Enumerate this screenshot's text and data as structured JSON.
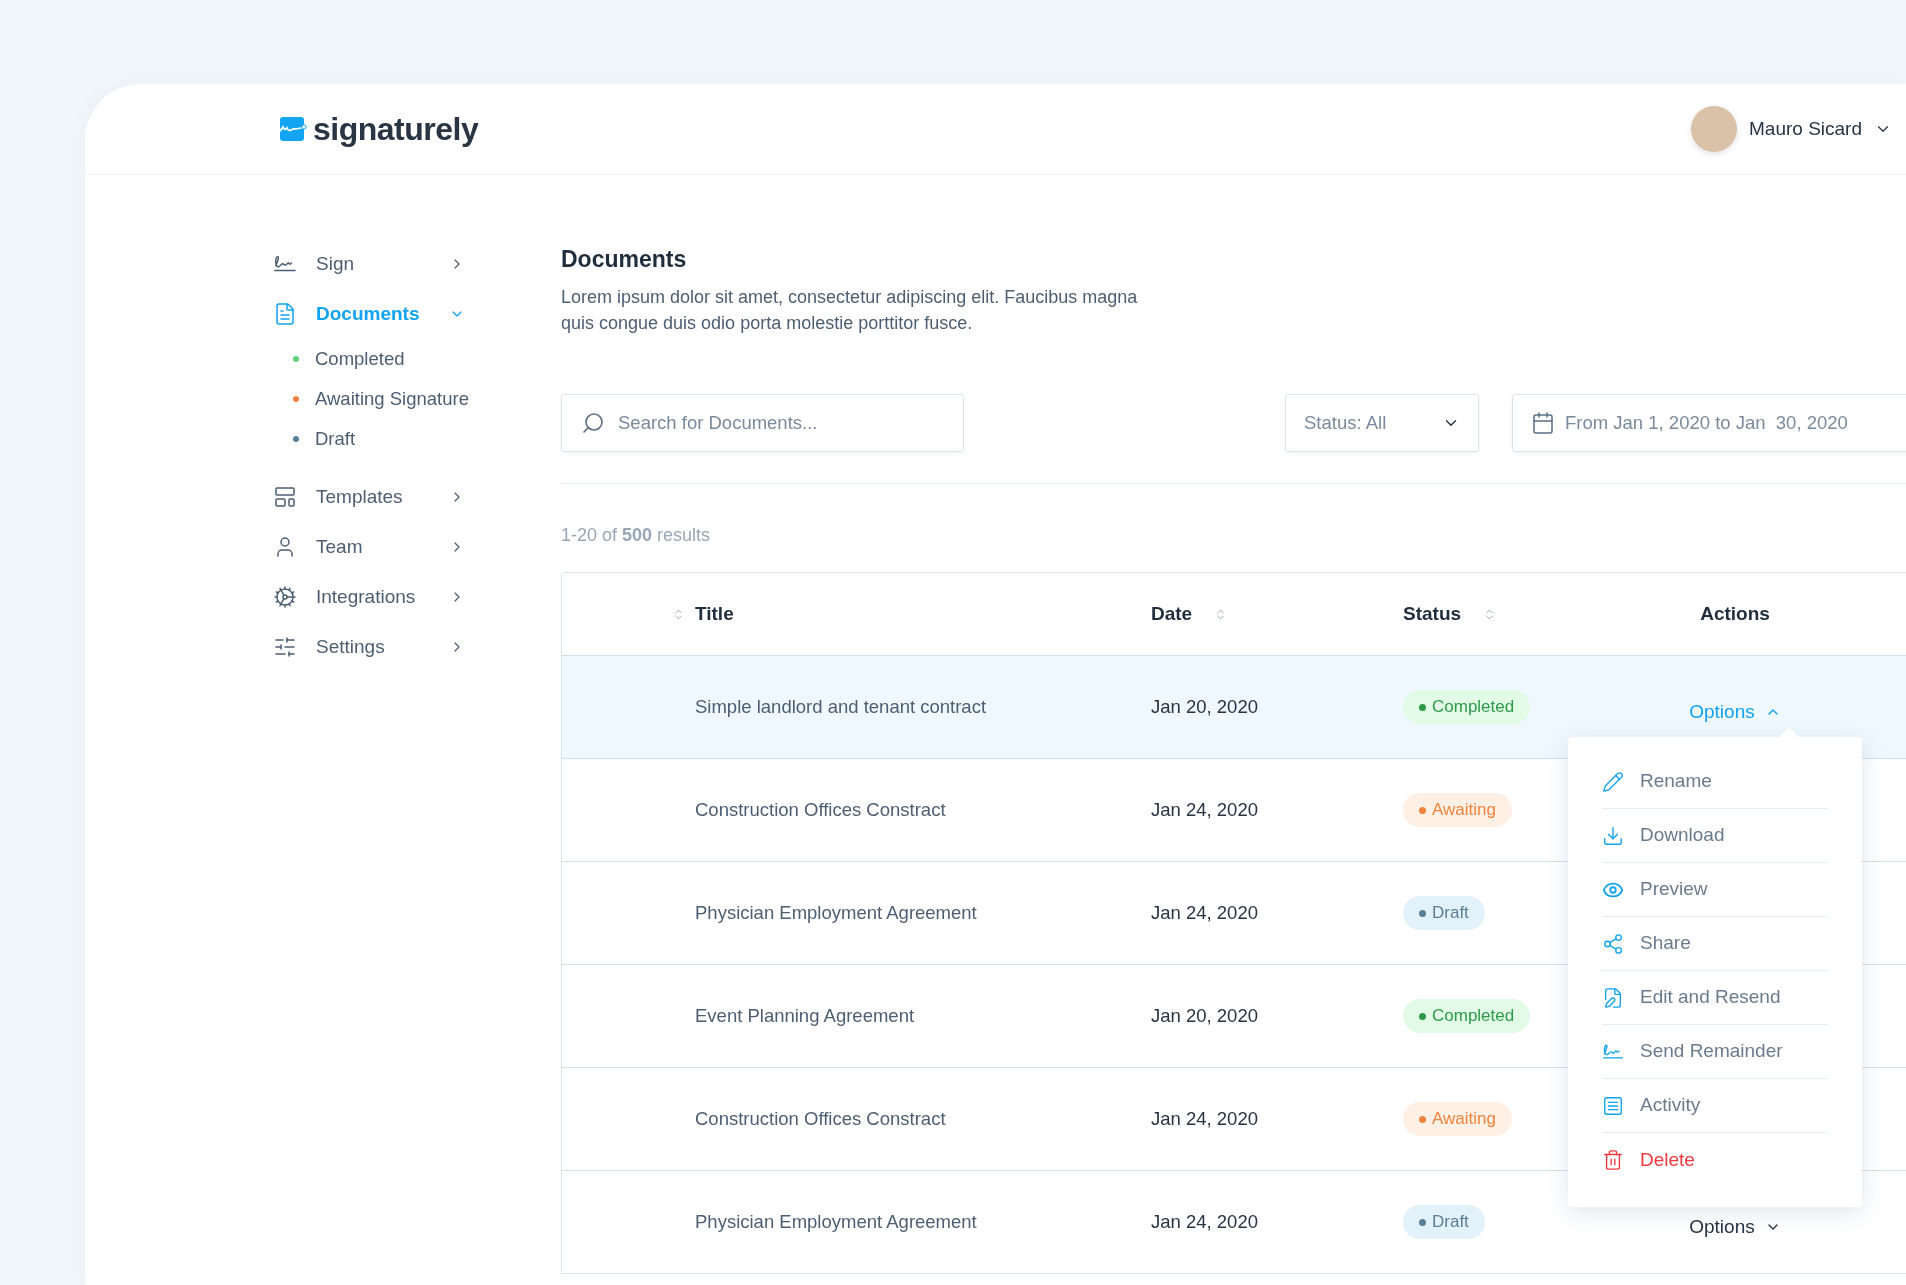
{
  "brand": {
    "name": "signaturely"
  },
  "user": {
    "name": "Mauro Sicard"
  },
  "sidebar": {
    "items": [
      {
        "label": "Sign",
        "selected": false,
        "expanded": false
      },
      {
        "label": "Documents",
        "selected": true,
        "expanded": true,
        "children": [
          {
            "label": "Completed",
            "color": "#5fd47a"
          },
          {
            "label": "Awaiting Signature",
            "color": "#f0843c"
          },
          {
            "label": "Draft",
            "color": "#5a7e95"
          }
        ]
      },
      {
        "label": "Templates",
        "selected": false,
        "expanded": false
      },
      {
        "label": "Team",
        "selected": false,
        "expanded": false
      },
      {
        "label": "Integrations",
        "selected": false,
        "expanded": false
      },
      {
        "label": "Settings",
        "selected": false,
        "expanded": false
      }
    ]
  },
  "page": {
    "title": "Documents",
    "description": "Lorem ipsum dolor sit amet, consectetur adipiscing elit. Faucibus magna quis congue duis odio porta molestie porttitor fusce."
  },
  "filters": {
    "search": {
      "placeholder": "Search for Documents..."
    },
    "status": {
      "value": "Status: All"
    },
    "date_range": {
      "value": "From Jan 1, 2020 to Jan  30, 2020"
    }
  },
  "results": "1-20 of **500** results",
  "table": {
    "columns": [
      {
        "label": "Title",
        "sortable": true
      },
      {
        "label": "Date",
        "sortable": true
      },
      {
        "label": "Status",
        "sortable": true
      },
      {
        "label": "Actions",
        "sortable": false
      }
    ],
    "rows": [
      {
        "title": "Simple landlord and tenant contract",
        "date": "Jan 20, 2020",
        "status": {
          "label": "Completed",
          "kind": "completed"
        },
        "selected": true,
        "action": {
          "label": "Options",
          "expanded": true
        }
      },
      {
        "title": "Construction Offices Constract",
        "date": "Jan 24, 2020",
        "status": {
          "label": "Awaiting",
          "kind": "awaiting"
        },
        "selected": false
      },
      {
        "title": "Physician Employment Agreement",
        "date": "Jan 24, 2020",
        "status": {
          "label": "Draft",
          "kind": "draft"
        },
        "selected": false
      },
      {
        "title": "Event Planning Agreement",
        "date": "Jan 20, 2020",
        "status": {
          "label": "Completed",
          "kind": "completed"
        },
        "selected": false
      },
      {
        "title": "Construction Offices Constract",
        "date": "Jan 24, 2020",
        "status": {
          "label": "Awaiting",
          "kind": "awaiting"
        },
        "selected": false
      },
      {
        "title": "Physician Employment Agreement",
        "date": "Jan 24, 2020",
        "status": {
          "label": "Draft",
          "kind": "draft"
        },
        "selected": false,
        "action": {
          "label": "Options",
          "expanded": false
        }
      }
    ]
  },
  "options_menu": {
    "items": [
      {
        "label": "Rename",
        "danger": false
      },
      {
        "label": "Download",
        "danger": false
      },
      {
        "label": "Preview",
        "danger": false
      },
      {
        "label": "Share",
        "danger": false
      },
      {
        "label": "Edit and Resend",
        "danger": false
      },
      {
        "label": "Send Remainder",
        "danger": false
      },
      {
        "label": "Activity",
        "danger": false
      },
      {
        "label": "Delete",
        "danger": true
      }
    ]
  }
}
